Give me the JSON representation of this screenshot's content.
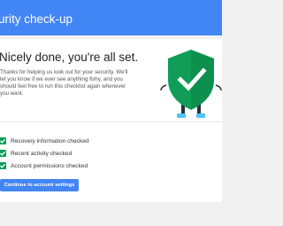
{
  "header": {
    "title": "urity check-up"
  },
  "main": {
    "heading": "Nicely done, you're all set.",
    "description_lines": [
      "Thanks for helping us look out for your security. We'll",
      "let you know if we ever see anything fishy, and you",
      "should feel free to run this checklist again whenever",
      "you want."
    ],
    "illustration": "shield-check-icon",
    "checklist": [
      {
        "label": "Recovery information checked",
        "icon": "check-icon"
      },
      {
        "label": "Recent activity checked",
        "icon": "check-icon"
      },
      {
        "label": "Account permissions checked",
        "icon": "check-icon"
      }
    ],
    "cta_label": "Continue to account settings"
  },
  "colors": {
    "header_blue": "#4285f4",
    "shield_green": "#0f9d58",
    "check_green": "#0f9d58",
    "page_background": "#f1f1f1"
  }
}
